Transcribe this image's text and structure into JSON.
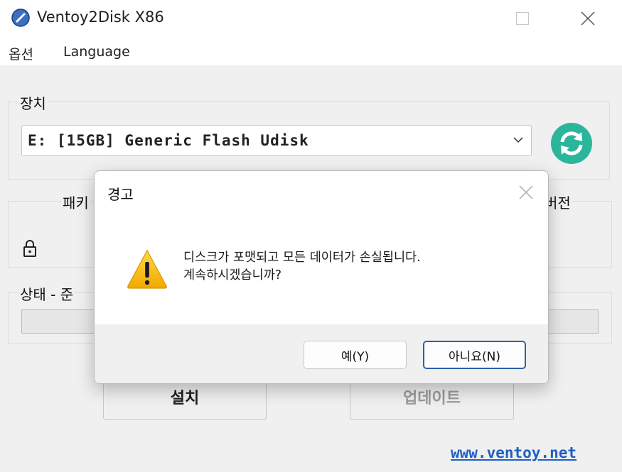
{
  "window": {
    "title": "Ventoy2Disk  X86",
    "icons": {
      "app": "ventoy-logo-icon",
      "minimize": "minimize-icon",
      "maximize": "maximize-icon",
      "close": "close-icon"
    }
  },
  "menu": {
    "options": "옵션",
    "language": "Language"
  },
  "device_group": {
    "label": "장치",
    "selected_device": "E: [15GB] Generic Flash Udisk",
    "refresh_icon": "refresh-icon",
    "refresh_color": "#2bb59a"
  },
  "package_group": {
    "label_partial": "패키",
    "version_partial": "버전",
    "lock_icon": "lock-icon"
  },
  "status_group": {
    "label_partial": "상태 - 준",
    "progress": 0
  },
  "buttons": {
    "install": "설치",
    "update": "업데이트"
  },
  "link": "www.ventoy.net",
  "dialog": {
    "title": "경고",
    "message_line1": "디스크가 포맷되고 모든 데이터가 손실됩니다.",
    "message_line2": "계속하시겠습니까?",
    "yes": "예(Y)",
    "no": "아니요(N)",
    "warning_icon": "warning-icon",
    "close_icon": "close-icon"
  }
}
